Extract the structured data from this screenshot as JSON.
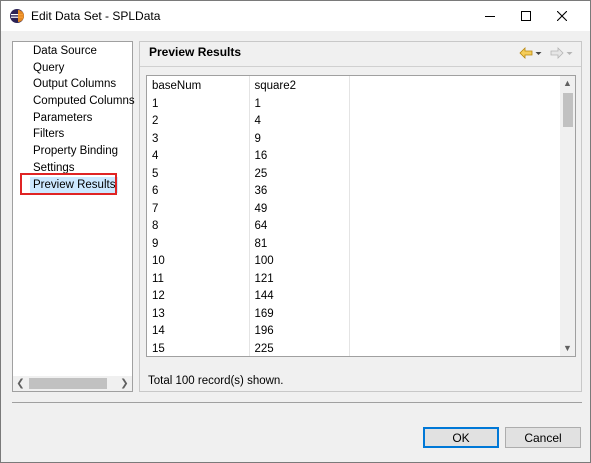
{
  "window": {
    "title": "Edit Data Set - SPLData"
  },
  "sidebar": {
    "items": [
      {
        "label": "Data Source"
      },
      {
        "label": "Query"
      },
      {
        "label": "Output Columns"
      },
      {
        "label": "Computed Columns"
      },
      {
        "label": "Parameters"
      },
      {
        "label": "Filters"
      },
      {
        "label": "Property Binding"
      },
      {
        "label": "Settings"
      },
      {
        "label": "Preview Results",
        "selected": true
      }
    ],
    "highlight_color": "#e02424",
    "selected_bg": "#cce8ff"
  },
  "main": {
    "title": "Preview Results",
    "table": {
      "columns": [
        "baseNum",
        "square2",
        ""
      ],
      "rows": [
        [
          "1",
          "1"
        ],
        [
          "2",
          "4"
        ],
        [
          "3",
          "9"
        ],
        [
          "4",
          "16"
        ],
        [
          "5",
          "25"
        ],
        [
          "6",
          "36"
        ],
        [
          "7",
          "49"
        ],
        [
          "8",
          "64"
        ],
        [
          "9",
          "81"
        ],
        [
          "10",
          "100"
        ],
        [
          "11",
          "121"
        ],
        [
          "12",
          "144"
        ],
        [
          "13",
          "169"
        ],
        [
          "14",
          "196"
        ],
        [
          "15",
          "225"
        ]
      ]
    },
    "total_text": "Total 100 record(s) shown."
  },
  "buttons": {
    "ok": "OK",
    "cancel": "Cancel"
  },
  "icons": {
    "app": "eclipse-icon",
    "back": "back-arrow-icon",
    "forward": "forward-arrow-icon"
  },
  "colors": {
    "accent": "#0078d7",
    "back_arrow": "#e8b43c"
  }
}
